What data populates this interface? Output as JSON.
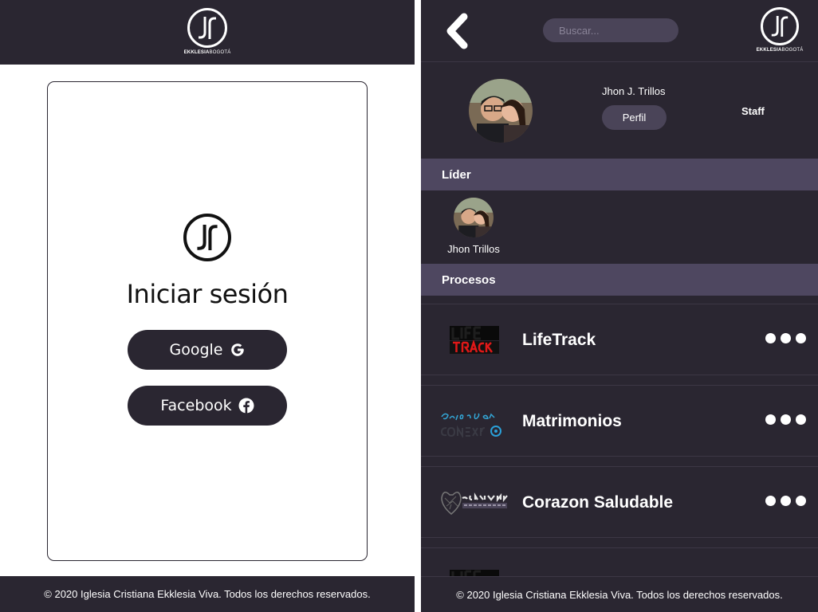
{
  "brand": {
    "logo_text_bold": "EKKLESIA",
    "logo_text_light": "BOGOTÁ"
  },
  "login": {
    "title": "Iniciar sesión",
    "google_label": "Google",
    "facebook_label": "Facebook",
    "footer": "© 2020 Iglesia Cristiana Ekklesia Viva. Todos los derechos reservados."
  },
  "dashboard": {
    "search_placeholder": "Buscar...",
    "user": {
      "name": "Jhon J. Trillos",
      "profile_button": "Perfil",
      "role": "Staff"
    },
    "leader_section": {
      "title": "Líder",
      "leader_name": "Jhon Trillos"
    },
    "processes_section": {
      "title": "Procesos",
      "items": [
        {
          "name": "LifeTrack",
          "logo": "lifetrack-logo"
        },
        {
          "name": "Matrimonios",
          "logo": "grupo-de-conexion-logo"
        },
        {
          "name": "Corazon Saludable",
          "logo": "corazon-saludable-logo"
        },
        {
          "name": "",
          "logo": "lifetrack-logo"
        }
      ]
    },
    "footer": "© 2020 Iglesia Cristiana Ekklesia Viva. Todos los derechos reservados."
  },
  "colors": {
    "dark": "#2a2631",
    "section": "#4e4760",
    "pill": "#4a4458",
    "white": "#ffffff"
  }
}
